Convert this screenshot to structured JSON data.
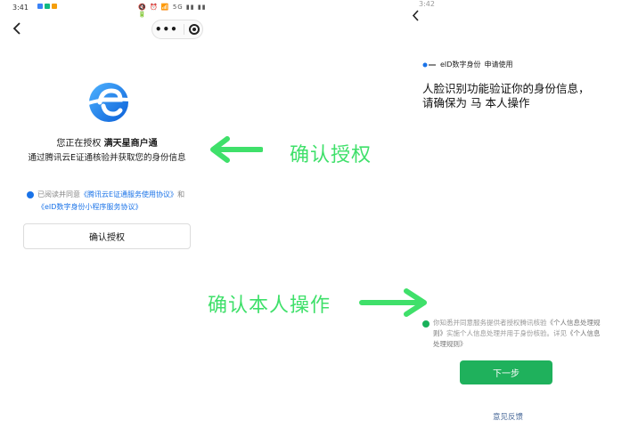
{
  "left_phone": {
    "status": {
      "time": "3:41",
      "icons_right": "🔇 ⏰ 📶 5G ▮▮ ▮▮ 🔋",
      "dot_colors": [
        "#3b82f6",
        "#10b981",
        "#f59e0b"
      ]
    },
    "auth_prefix": "您正在授权",
    "auth_name": "满天星商户通",
    "auth_desc": "通过腾讯云E证通核验并获取您的身份信息",
    "consent_prefix": "已阅读并同意",
    "consent_link1": "《腾讯云E证通服务使用协议》",
    "consent_and": "和",
    "consent_link2": "《eID数字身份小程序服务协议》",
    "confirm_label": "确认授权"
  },
  "annotations": {
    "confirm_auth": "确认授权",
    "confirm_self": "确认本人操作",
    "arrow_color": "#3fe06a"
  },
  "right_phone": {
    "status_partial": "3:42",
    "eid_brand": "eID数字身份",
    "eid_suffix": "申请使用",
    "verify_line1": "人脸识别功能验证你的身份信息，",
    "verify_line2": "请确保为 马   本人操作",
    "consent_text": "你知悉并同意服务提供者授权腾讯核验",
    "consent_link_a": "《个人信息处理规则》",
    "consent_mid": "实施个人信息处理并用于身份核验。详见",
    "consent_link_b": "《个人信息处理规则》",
    "next_label": "下一步",
    "feedback_label": "意见反馈",
    "accent_color": "#1fb15c"
  }
}
